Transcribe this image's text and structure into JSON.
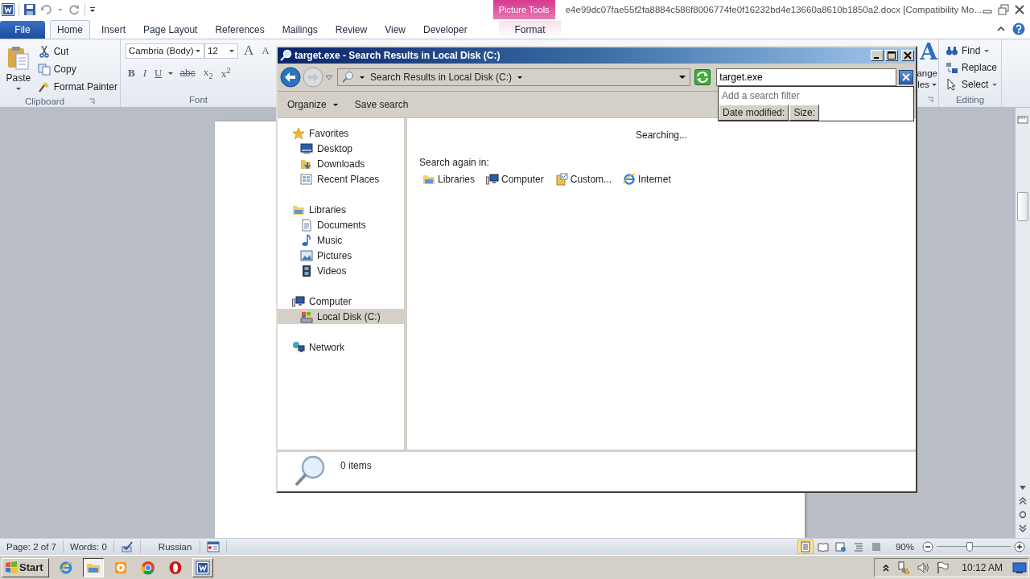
{
  "word": {
    "document_title": "e4e99dc07fae55f2fa8884c586f8006774fe0f16232bd4e13660a8610b1850a2.docx [Compatibility Mo...",
    "contextual_group": "Picture Tools",
    "tabs": [
      {
        "label": "File",
        "kind": "file",
        "selected": false
      },
      {
        "label": "Home",
        "kind": "normal",
        "selected": true
      },
      {
        "label": "Insert",
        "kind": "normal",
        "selected": false
      },
      {
        "label": "Page Layout",
        "kind": "normal",
        "selected": false
      },
      {
        "label": "References",
        "kind": "normal",
        "selected": false
      },
      {
        "label": "Mailings",
        "kind": "normal",
        "selected": false
      },
      {
        "label": "Review",
        "kind": "normal",
        "selected": false
      },
      {
        "label": "View",
        "kind": "normal",
        "selected": false
      },
      {
        "label": "Developer",
        "kind": "normal",
        "selected": false
      },
      {
        "label": "Format",
        "kind": "contextual",
        "selected": false
      }
    ],
    "clipboard": {
      "paste": "Paste",
      "cut": "Cut",
      "copy": "Copy",
      "format_painter": "Format Painter",
      "label": "Clipboard"
    },
    "font": {
      "font_name": "Cambria (Body)",
      "font_size": "12",
      "grow": "A",
      "shrink": "A",
      "bold": "B",
      "italic": "I",
      "underline": "U",
      "strikethrough": "abc",
      "subscript": "x$_{2}$",
      "superscript": "x$^{2}$",
      "label": "Font"
    },
    "styles": {
      "glyph": "A",
      "line_1": "ange",
      "line_2": "les"
    },
    "editing": {
      "find": "Find",
      "replace": "Replace",
      "select": "Select",
      "label": "Editing"
    },
    "status_bar": {
      "page": "Page: 2 of 7",
      "words": "Words: 0",
      "language": "Russian",
      "views": [
        {
          "kind": "print",
          "selected": true
        },
        {
          "kind": "reading",
          "selected": false
        },
        {
          "kind": "web",
          "selected": false
        },
        {
          "kind": "outline",
          "selected": false
        },
        {
          "kind": "draft",
          "selected": false
        }
      ],
      "zoom": "90%",
      "zoom_slider": {
        "level": 0.45
      }
    }
  },
  "explorer": {
    "title": "target.exe - Search Results in Local Disk (C:)",
    "address": "Search Results in Local Disk (C:)",
    "search": {
      "value": "target.exe"
    },
    "search_filter": {
      "hint": "Add a search filter",
      "filters": [
        "Date modified:",
        "Size:"
      ]
    },
    "toolbar": [
      {
        "label": "Organize",
        "kind": "menu"
      },
      {
        "label": "Save search",
        "kind": "button"
      }
    ],
    "nav": [
      {
        "label": "Favorites",
        "selected": false,
        "children": [
          {
            "label": "Desktop",
            "selected": false
          },
          {
            "label": "Downloads",
            "selected": false
          },
          {
            "label": "Recent Places",
            "selected": false
          }
        ]
      },
      {
        "label": "Libraries",
        "selected": false,
        "children": [
          {
            "label": "Documents",
            "selected": false
          },
          {
            "label": "Music",
            "selected": false
          },
          {
            "label": "Pictures",
            "selected": false
          },
          {
            "label": "Videos",
            "selected": false
          }
        ]
      },
      {
        "label": "Computer",
        "selected": false,
        "children": [
          {
            "label": "Local Disk (C:)",
            "selected": true
          }
        ]
      },
      {
        "label": "Network",
        "selected": false
      }
    ],
    "status": "Searching...",
    "search_again_label": "Search again in:",
    "search_again": [
      "Libraries",
      "Computer",
      "Custom...",
      "Internet"
    ],
    "details": "0 items"
  },
  "taskbar": {
    "start": "Start",
    "apps": [
      {
        "kind": "ie",
        "open": false,
        "selected": false
      },
      {
        "kind": "explorer",
        "open": true,
        "selected": true
      },
      {
        "kind": "media",
        "open": false,
        "selected": false
      },
      {
        "kind": "chrome",
        "open": false,
        "selected": false
      },
      {
        "kind": "opera",
        "open": false,
        "selected": false
      },
      {
        "kind": "word",
        "open": true,
        "selected": false
      }
    ],
    "clock": "10:12 AM"
  }
}
